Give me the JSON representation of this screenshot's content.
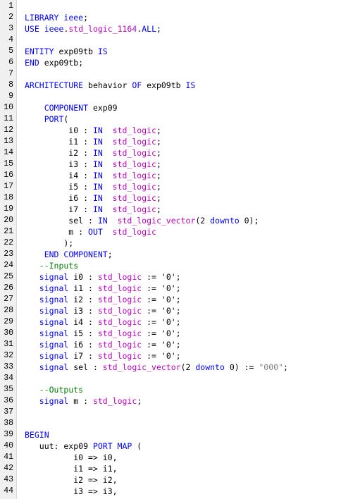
{
  "colors": {
    "keyword": "#0000ff",
    "type": "#c000c0",
    "comment": "#008000",
    "string": "#808080",
    "plain": "#000000",
    "gutter_bg": "#f0f0f0"
  },
  "lines": [
    {
      "num": "1",
      "tokens": []
    },
    {
      "num": "2",
      "tokens": [
        [
          "kw",
          "LIBRARY "
        ],
        [
          "kw",
          "ieee"
        ],
        [
          "pl",
          ";"
        ]
      ]
    },
    {
      "num": "3",
      "tokens": [
        [
          "kw",
          "USE "
        ],
        [
          "kw",
          "ieee"
        ],
        [
          "pl",
          "."
        ],
        [
          "ty",
          "std_logic_1164"
        ],
        [
          "pl",
          "."
        ],
        [
          "kw",
          "ALL"
        ],
        [
          "pl",
          ";"
        ]
      ]
    },
    {
      "num": "4",
      "tokens": []
    },
    {
      "num": "5",
      "tokens": [
        [
          "kw",
          "ENTITY "
        ],
        [
          "pl",
          "exp09tb "
        ],
        [
          "kw",
          "IS"
        ]
      ]
    },
    {
      "num": "6",
      "tokens": [
        [
          "kw",
          "END "
        ],
        [
          "pl",
          "exp09tb;"
        ]
      ]
    },
    {
      "num": "7",
      "tokens": []
    },
    {
      "num": "8",
      "tokens": [
        [
          "kw",
          "ARCHITECTURE "
        ],
        [
          "pl",
          "behavior "
        ],
        [
          "kw",
          "OF "
        ],
        [
          "pl",
          "exp09tb "
        ],
        [
          "kw",
          "IS"
        ]
      ]
    },
    {
      "num": "9",
      "tokens": []
    },
    {
      "num": "10",
      "tokens": [
        [
          "pl",
          "    "
        ],
        [
          "kw",
          "COMPONENT "
        ],
        [
          "pl",
          "exp09"
        ]
      ]
    },
    {
      "num": "11",
      "tokens": [
        [
          "pl",
          "    "
        ],
        [
          "kw",
          "PORT"
        ],
        [
          "pl",
          "("
        ]
      ]
    },
    {
      "num": "12",
      "tokens": [
        [
          "pl",
          "         i0 : "
        ],
        [
          "kw",
          "IN  "
        ],
        [
          "ty",
          "std_logic"
        ],
        [
          "pl",
          ";"
        ]
      ]
    },
    {
      "num": "13",
      "tokens": [
        [
          "pl",
          "         i1 : "
        ],
        [
          "kw",
          "IN  "
        ],
        [
          "ty",
          "std_logic"
        ],
        [
          "pl",
          ";"
        ]
      ]
    },
    {
      "num": "14",
      "tokens": [
        [
          "pl",
          "         i2 : "
        ],
        [
          "kw",
          "IN  "
        ],
        [
          "ty",
          "std_logic"
        ],
        [
          "pl",
          ";"
        ]
      ]
    },
    {
      "num": "15",
      "tokens": [
        [
          "pl",
          "         i3 : "
        ],
        [
          "kw",
          "IN  "
        ],
        [
          "ty",
          "std_logic"
        ],
        [
          "pl",
          ";"
        ]
      ]
    },
    {
      "num": "16",
      "tokens": [
        [
          "pl",
          "         i4 : "
        ],
        [
          "kw",
          "IN  "
        ],
        [
          "ty",
          "std_logic"
        ],
        [
          "pl",
          ";"
        ]
      ]
    },
    {
      "num": "17",
      "tokens": [
        [
          "pl",
          "         i5 : "
        ],
        [
          "kw",
          "IN  "
        ],
        [
          "ty",
          "std_logic"
        ],
        [
          "pl",
          ";"
        ]
      ]
    },
    {
      "num": "18",
      "tokens": [
        [
          "pl",
          "         i6 : "
        ],
        [
          "kw",
          "IN  "
        ],
        [
          "ty",
          "std_logic"
        ],
        [
          "pl",
          ";"
        ]
      ]
    },
    {
      "num": "19",
      "tokens": [
        [
          "pl",
          "         i7 : "
        ],
        [
          "kw",
          "IN  "
        ],
        [
          "ty",
          "std_logic"
        ],
        [
          "pl",
          ";"
        ]
      ]
    },
    {
      "num": "20",
      "tokens": [
        [
          "pl",
          "         sel : "
        ],
        [
          "kw",
          "IN  "
        ],
        [
          "ty",
          "std_logic_vector"
        ],
        [
          "pl",
          "(2 "
        ],
        [
          "kw",
          "downto "
        ],
        [
          "pl",
          "0);"
        ]
      ]
    },
    {
      "num": "21",
      "tokens": [
        [
          "pl",
          "         m : "
        ],
        [
          "kw",
          "OUT  "
        ],
        [
          "ty",
          "std_logic"
        ]
      ]
    },
    {
      "num": "22",
      "tokens": [
        [
          "pl",
          "        );"
        ]
      ]
    },
    {
      "num": "23",
      "tokens": [
        [
          "pl",
          "    "
        ],
        [
          "kw",
          "END COMPONENT"
        ],
        [
          "pl",
          ";"
        ]
      ]
    },
    {
      "num": "24",
      "tokens": [
        [
          "pl",
          "   "
        ],
        [
          "cm",
          "--Inputs"
        ]
      ]
    },
    {
      "num": "25",
      "tokens": [
        [
          "pl",
          "   "
        ],
        [
          "kw",
          "signal "
        ],
        [
          "pl",
          "i0 : "
        ],
        [
          "ty",
          "std_logic "
        ],
        [
          "pl",
          ":= '0';"
        ]
      ]
    },
    {
      "num": "26",
      "tokens": [
        [
          "pl",
          "   "
        ],
        [
          "kw",
          "signal "
        ],
        [
          "pl",
          "i1 : "
        ],
        [
          "ty",
          "std_logic "
        ],
        [
          "pl",
          ":= '0';"
        ]
      ]
    },
    {
      "num": "27",
      "tokens": [
        [
          "pl",
          "   "
        ],
        [
          "kw",
          "signal "
        ],
        [
          "pl",
          "i2 : "
        ],
        [
          "ty",
          "std_logic "
        ],
        [
          "pl",
          ":= '0';"
        ]
      ]
    },
    {
      "num": "28",
      "tokens": [
        [
          "pl",
          "   "
        ],
        [
          "kw",
          "signal "
        ],
        [
          "pl",
          "i3 : "
        ],
        [
          "ty",
          "std_logic "
        ],
        [
          "pl",
          ":= '0';"
        ]
      ]
    },
    {
      "num": "29",
      "tokens": [
        [
          "pl",
          "   "
        ],
        [
          "kw",
          "signal "
        ],
        [
          "pl",
          "i4 : "
        ],
        [
          "ty",
          "std_logic "
        ],
        [
          "pl",
          ":= '0';"
        ]
      ]
    },
    {
      "num": "30",
      "tokens": [
        [
          "pl",
          "   "
        ],
        [
          "kw",
          "signal "
        ],
        [
          "pl",
          "i5 : "
        ],
        [
          "ty",
          "std_logic "
        ],
        [
          "pl",
          ":= '0';"
        ]
      ]
    },
    {
      "num": "31",
      "tokens": [
        [
          "pl",
          "   "
        ],
        [
          "kw",
          "signal "
        ],
        [
          "pl",
          "i6 : "
        ],
        [
          "ty",
          "std_logic "
        ],
        [
          "pl",
          ":= '0';"
        ]
      ]
    },
    {
      "num": "32",
      "tokens": [
        [
          "pl",
          "   "
        ],
        [
          "kw",
          "signal "
        ],
        [
          "pl",
          "i7 : "
        ],
        [
          "ty",
          "std_logic "
        ],
        [
          "pl",
          ":= '0';"
        ]
      ]
    },
    {
      "num": "33",
      "tokens": [
        [
          "pl",
          "   "
        ],
        [
          "kw",
          "signal "
        ],
        [
          "pl",
          "sel : "
        ],
        [
          "ty",
          "std_logic_vector"
        ],
        [
          "pl",
          "(2 "
        ],
        [
          "kw",
          "downto "
        ],
        [
          "pl",
          "0) := "
        ],
        [
          "st",
          "\"000\""
        ],
        [
          "pl",
          ";"
        ]
      ]
    },
    {
      "num": "34",
      "tokens": []
    },
    {
      "num": "35",
      "tokens": [
        [
          "pl",
          "   "
        ],
        [
          "cm",
          "--Outputs"
        ]
      ]
    },
    {
      "num": "36",
      "tokens": [
        [
          "pl",
          "   "
        ],
        [
          "kw",
          "signal "
        ],
        [
          "pl",
          "m : "
        ],
        [
          "ty",
          "std_logic"
        ],
        [
          "pl",
          ";"
        ]
      ]
    },
    {
      "num": "37",
      "tokens": []
    },
    {
      "num": "38",
      "tokens": []
    },
    {
      "num": "39",
      "tokens": [
        [
          "kw",
          "BEGIN"
        ]
      ]
    },
    {
      "num": "40",
      "tokens": [
        [
          "pl",
          "   uut: exp09 "
        ],
        [
          "kw",
          "PORT MAP "
        ],
        [
          "pl",
          "("
        ]
      ]
    },
    {
      "num": "41",
      "tokens": [
        [
          "pl",
          "          i0 => i0,"
        ]
      ]
    },
    {
      "num": "42",
      "tokens": [
        [
          "pl",
          "          i1 => i1,"
        ]
      ]
    },
    {
      "num": "43",
      "tokens": [
        [
          "pl",
          "          i2 => i2,"
        ]
      ]
    },
    {
      "num": "44",
      "tokens": [
        [
          "pl",
          "          i3 => i3,"
        ]
      ]
    }
  ]
}
